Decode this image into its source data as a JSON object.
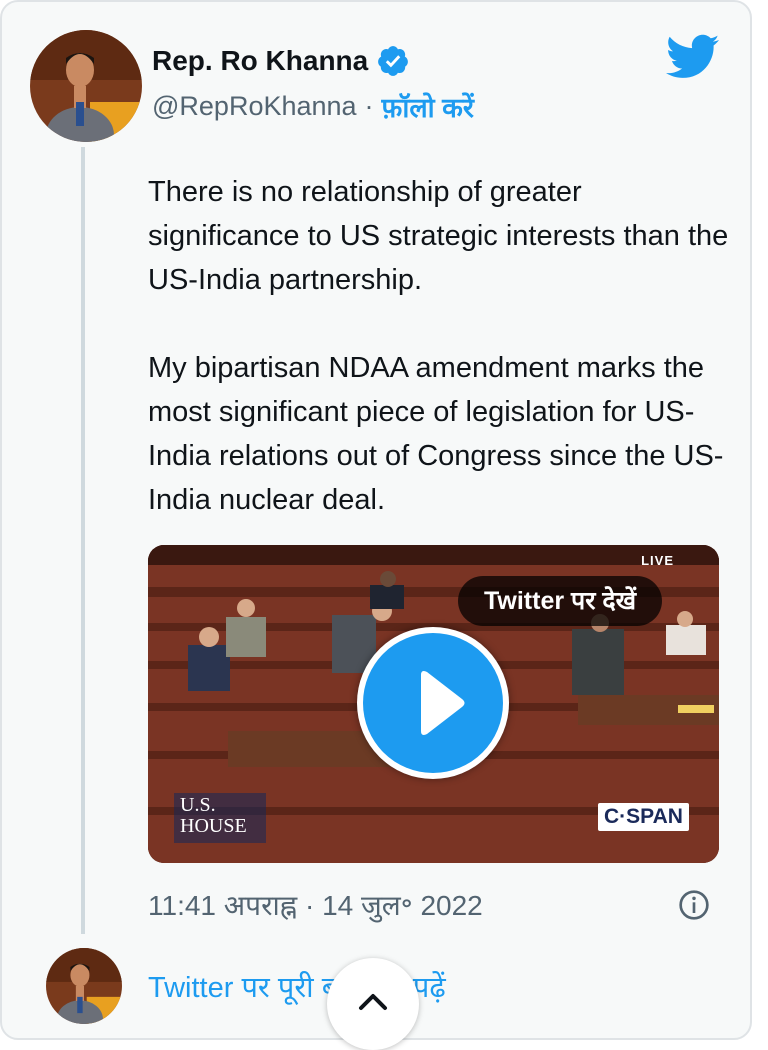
{
  "tweet": {
    "author_name": "Rep. Ro Khanna",
    "handle": "@RepRoKhanna",
    "separator": "·",
    "follow_label": "फ़ॉलो करें",
    "paragraphs": [
      "There is no relationship of greater significance to US strategic interests than the US-India partnership.",
      "My bipartisan NDAA amendment marks the most significant piece of legislation for US-India relations out of Congress since the US-India nuclear deal."
    ],
    "timestamp": "11:41 अपराह्न · 14 जुल॰ 2022"
  },
  "video": {
    "live_label": "LIVE",
    "watch_label": "Twitter पर देखें",
    "house_logo_line1": "U.S.",
    "house_logo_line2": "HOUSE",
    "cspan_label": "C·SPAN"
  },
  "footer": {
    "read_conversation": "Twitter पर पूरी बातचीत पढ़ें"
  },
  "icons": {
    "verified": "verified-badge-icon",
    "twitter": "twitter-bird-icon",
    "play": "play-icon",
    "info": "info-icon",
    "scroll_up": "chevron-up-icon"
  },
  "colors": {
    "accent": "#1d9bf0",
    "text": "#0f1419",
    "secondary": "#536471",
    "card_bg": "#f7f9f9"
  }
}
